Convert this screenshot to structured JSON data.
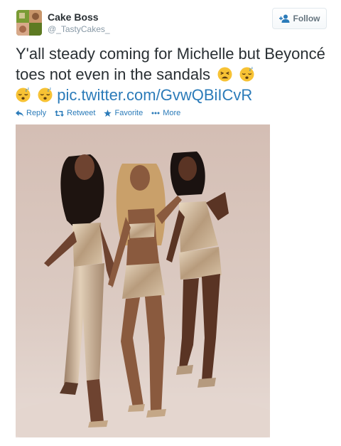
{
  "user": {
    "display_name": "Cake Boss",
    "handle": "@_TastyCakes_"
  },
  "follow_button": {
    "label": "Follow",
    "icon": "add-user-icon"
  },
  "tweet": {
    "text_part1": "Y'all steady coming for Michelle but Beyoncé toes not even in the sandals",
    "link": "pic.twitter.com/GvwQBiICvR",
    "emojis": [
      "tired-face-emoji",
      "sleeping-face-emoji",
      "sleeping-face-emoji",
      "sleeping-face-emoji"
    ]
  },
  "actions": {
    "reply": "Reply",
    "retweet": "Retweet",
    "favorite": "Favorite",
    "more": "More"
  },
  "photo": {
    "subject": "three-women-gold-outfits-photo"
  },
  "colors": {
    "link": "#2b7bb9",
    "muted": "#8899a6",
    "text": "#292f33"
  }
}
